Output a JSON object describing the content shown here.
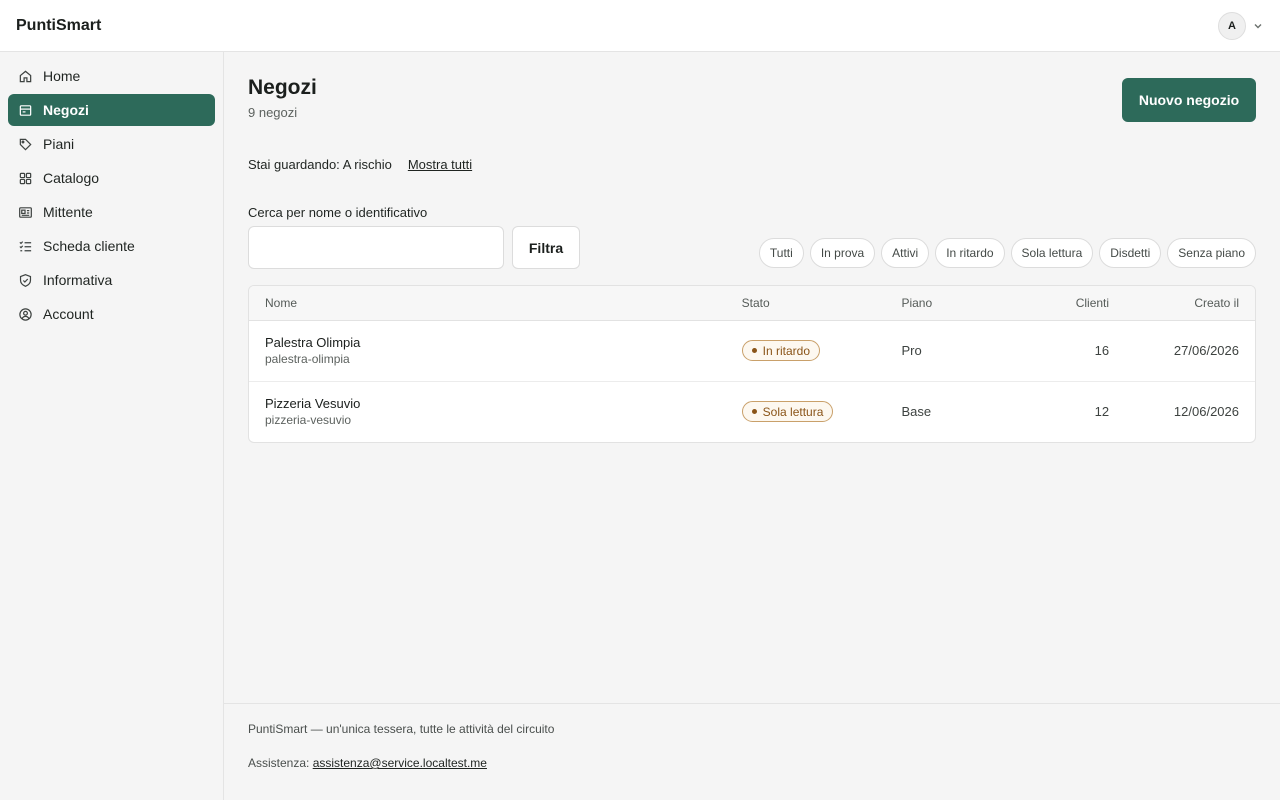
{
  "app": {
    "brand": "PuntiSmart"
  },
  "user": {
    "initial": "A"
  },
  "sidebar": {
    "items": [
      {
        "label": "Home",
        "icon": "home-icon"
      },
      {
        "label": "Negozi",
        "icon": "store-icon",
        "active": true
      },
      {
        "label": "Piani",
        "icon": "tag-icon"
      },
      {
        "label": "Catalogo",
        "icon": "grid-icon"
      },
      {
        "label": "Mittente",
        "icon": "id-card-icon"
      },
      {
        "label": "Scheda cliente",
        "icon": "checklist-icon"
      },
      {
        "label": "Informativa",
        "icon": "shield-check-icon"
      },
      {
        "label": "Account",
        "icon": "user-circle-icon"
      }
    ]
  },
  "page": {
    "title": "Negozi",
    "subtitle": "9 negozi",
    "new_button": "Nuovo negozio"
  },
  "filter_notice": {
    "text": "Stai guardando: A rischio",
    "show_all": "Mostra tutti"
  },
  "search": {
    "label": "Cerca per nome o identificativo",
    "value": "",
    "button": "Filtra"
  },
  "chips": [
    "Tutti",
    "In prova",
    "Attivi",
    "In ritardo",
    "Sola lettura",
    "Disdetti",
    "Senza piano"
  ],
  "table": {
    "headers": {
      "name": "Nome",
      "status": "Stato",
      "plan": "Piano",
      "clients": "Clienti",
      "created": "Creato il"
    },
    "rows": [
      {
        "name": "Palestra Olimpia",
        "slug": "palestra-olimpia",
        "status": "In ritardo",
        "plan": "Pro",
        "clients": "16",
        "created": "27/06/2026"
      },
      {
        "name": "Pizzeria Vesuvio",
        "slug": "pizzeria-vesuvio",
        "status": "Sola lettura",
        "plan": "Base",
        "clients": "12",
        "created": "12/06/2026"
      }
    ]
  },
  "footer": {
    "tagline": "PuntiSmart — un'unica tessera, tutte le attività del circuito",
    "help_label": "Assistenza:",
    "help_email": "assistenza@service.localtest.me"
  },
  "colors": {
    "accent": "#2d6a5a",
    "badge_warning": "#8a5418"
  }
}
